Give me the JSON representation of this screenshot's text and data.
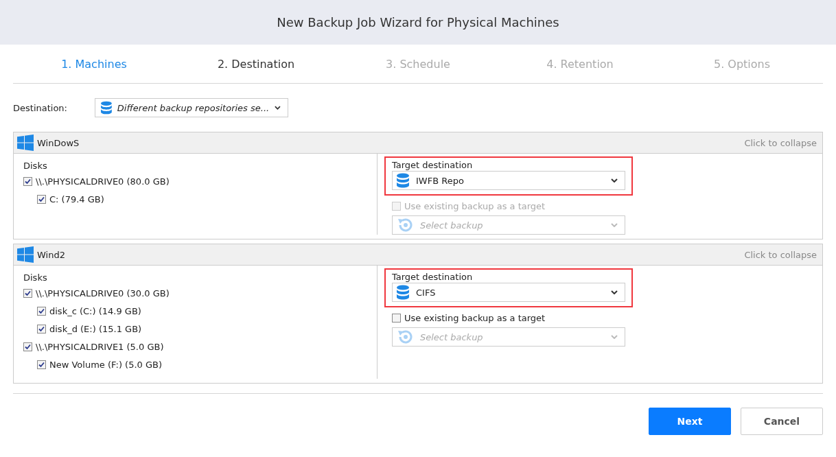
{
  "window": {
    "title": "New Backup Job Wizard for Physical Machines"
  },
  "steps": [
    {
      "label": "1. Machines",
      "completed": true,
      "selected": false
    },
    {
      "label": "2. Destination",
      "completed": false,
      "selected": true
    },
    {
      "label": "3. Schedule",
      "completed": false,
      "selected": false
    },
    {
      "label": "4. Retention",
      "completed": false,
      "selected": false
    },
    {
      "label": "5. Options",
      "completed": false,
      "selected": false
    }
  ],
  "destination": {
    "label": "Destination:",
    "value": "Different backup repositories se..."
  },
  "machines": [
    {
      "name": "WinDowS",
      "collapse_label": "Click to collapse",
      "disks_label": "Disks",
      "disks": [
        {
          "label": "\\\\.\\PHYSICALDRIVE0 (80.0 GB)",
          "checked": true,
          "children": [
            {
              "label": "C: (79.4 GB)",
              "checked": true
            }
          ]
        }
      ],
      "target_label": "Target destination",
      "target": "IWFB Repo",
      "highlighted": true,
      "use_existing": {
        "label": "Use existing backup as a target",
        "checked": false,
        "disabled": true
      },
      "backup_select": {
        "placeholder": "Select backup",
        "disabled": true
      }
    },
    {
      "name": "Wind2",
      "collapse_label": "Click to collapse",
      "disks_label": "Disks",
      "disks": [
        {
          "label": "\\\\.\\PHYSICALDRIVE0 (30.0 GB)",
          "checked": true,
          "children": [
            {
              "label": "disk_c (C:) (14.9 GB)",
              "checked": true
            },
            {
              "label": "disk_d (E:) (15.1 GB)",
              "checked": true
            }
          ]
        },
        {
          "label": "\\\\.\\PHYSICALDRIVE1 (5.0 GB)",
          "checked": true,
          "children": [
            {
              "label": "New Volume (F:) (5.0 GB)",
              "checked": true
            }
          ]
        }
      ],
      "target_label": "Target destination",
      "target": "CIFS",
      "highlighted": true,
      "use_existing": {
        "label": "Use existing backup as a target",
        "checked": false,
        "disabled": false
      },
      "backup_select": {
        "placeholder": "Select backup",
        "disabled": true
      }
    }
  ],
  "buttons": [
    {
      "label": "Next",
      "kind": "primary"
    },
    {
      "label": "Cancel",
      "kind": "secondary"
    }
  ]
}
